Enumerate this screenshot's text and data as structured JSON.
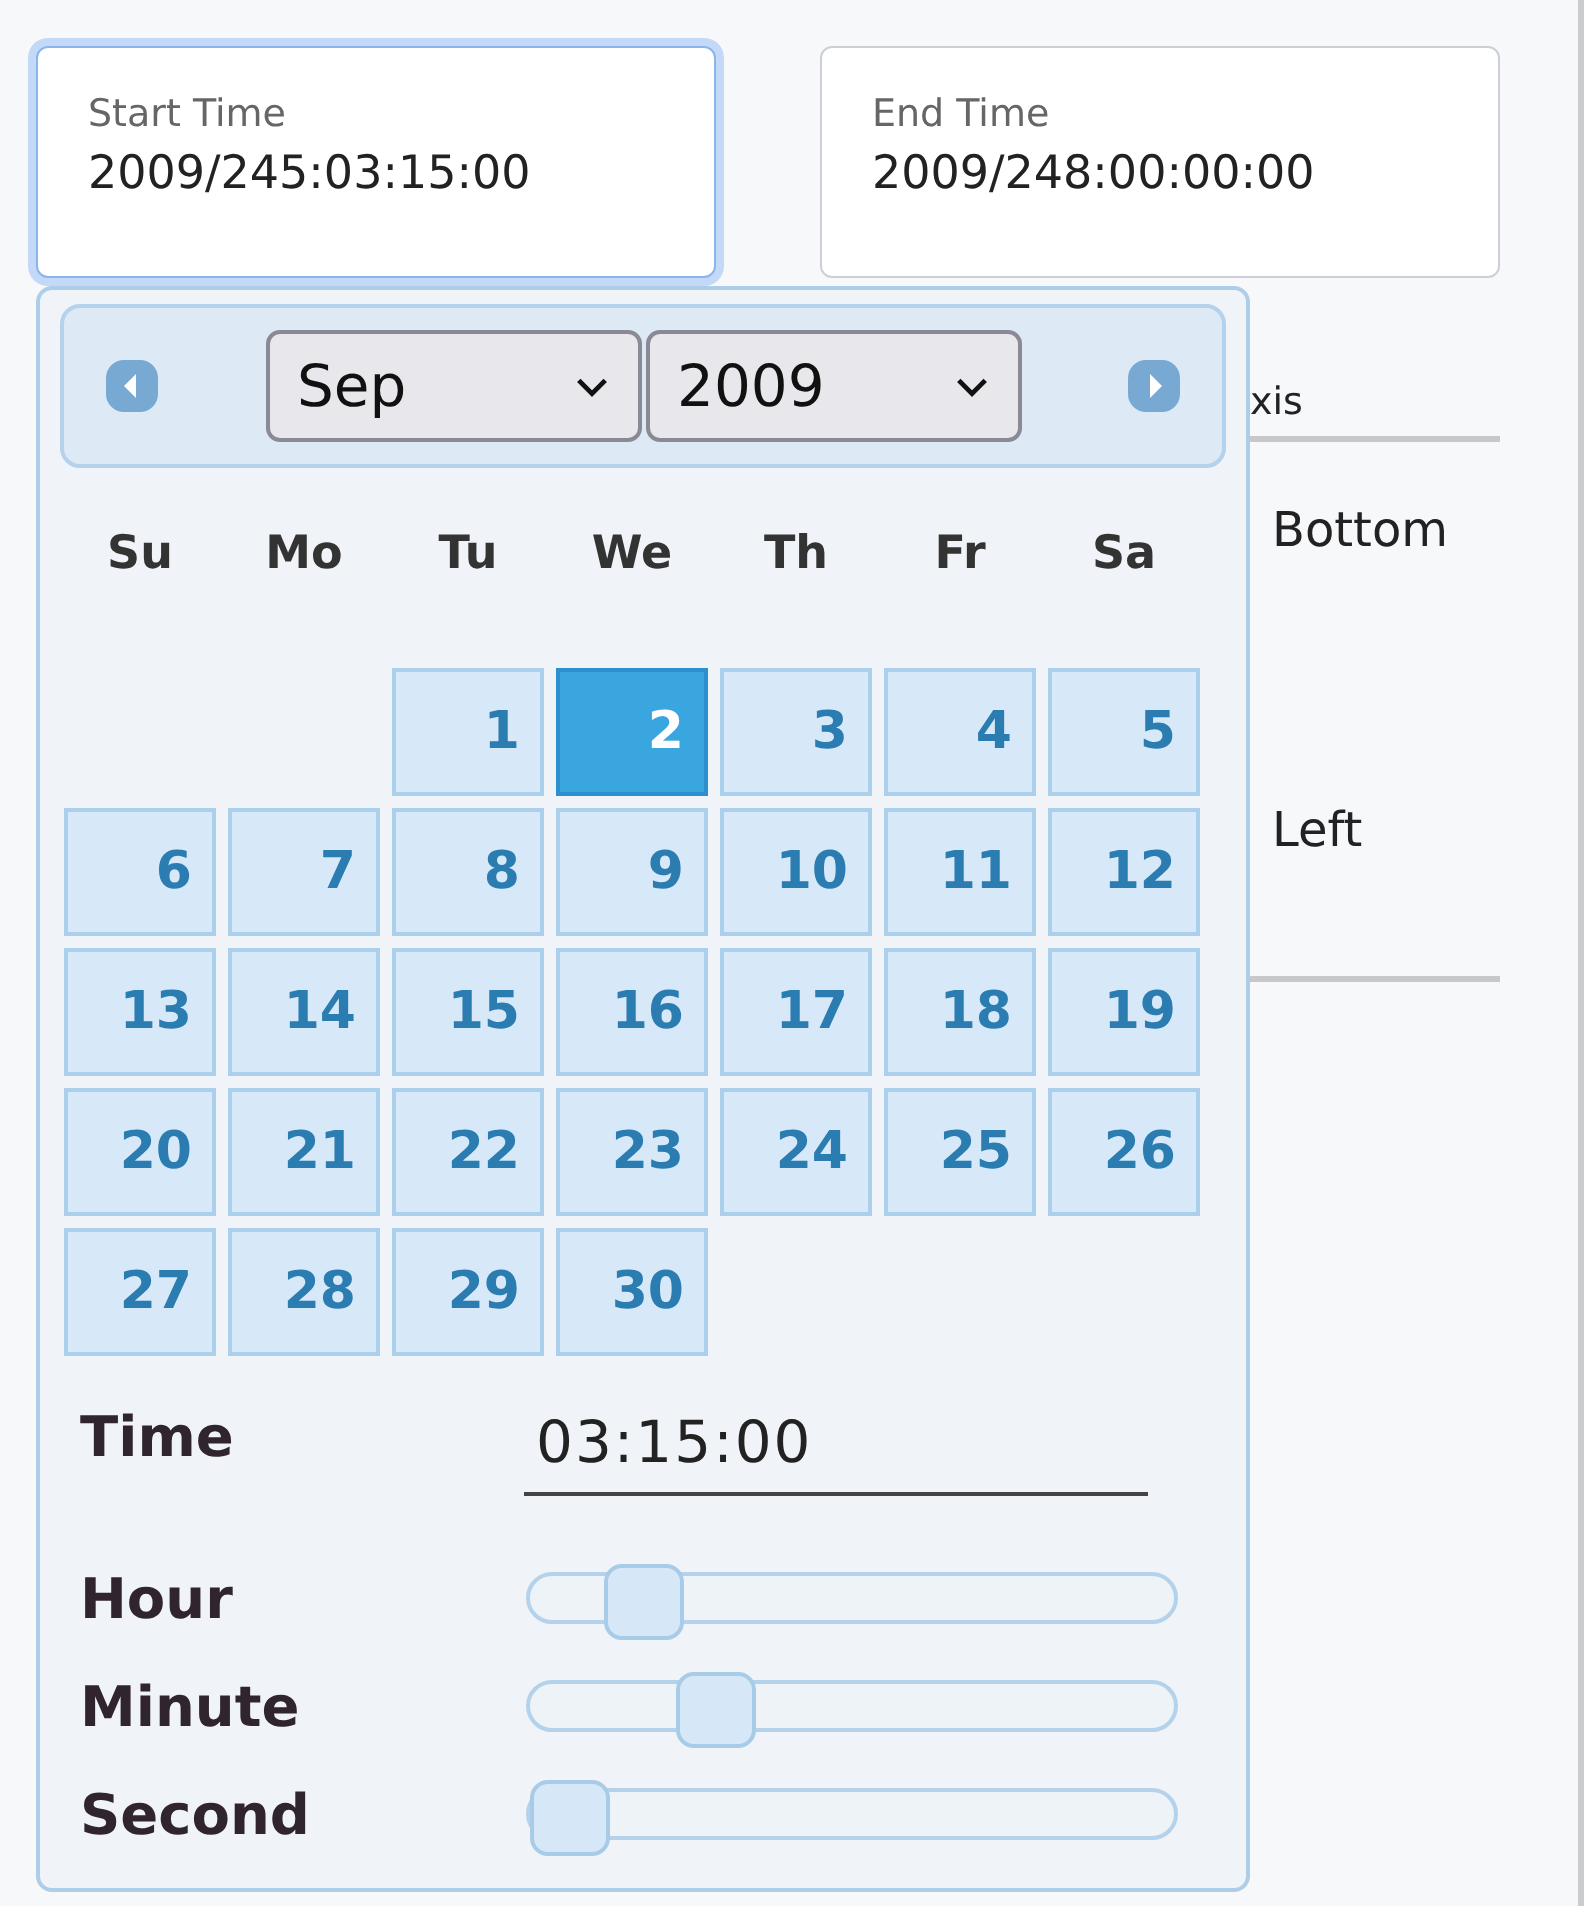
{
  "fields": [
    {
      "label": "Start Time",
      "value": "2009/245:03:15:00",
      "focused": true
    },
    {
      "label": "End Time",
      "value": "2009/248:00:00:00",
      "focused": false
    }
  ],
  "axis_panel": {
    "header": "xis",
    "options": [
      "Bottom",
      "Left"
    ]
  },
  "datepicker": {
    "month": "Sep",
    "year": "2009",
    "weekdays": [
      "Su",
      "Mo",
      "Tu",
      "We",
      "Th",
      "Fr",
      "Sa"
    ],
    "days": [
      {
        "kind": "blank"
      },
      {
        "kind": "blank"
      },
      {
        "label": "1",
        "selected": false
      },
      {
        "label": "2",
        "selected": true
      },
      {
        "label": "3",
        "selected": false
      },
      {
        "label": "4",
        "selected": false
      },
      {
        "label": "5",
        "selected": false
      },
      {
        "label": "6",
        "selected": false
      },
      {
        "label": "7",
        "selected": false
      },
      {
        "label": "8",
        "selected": false
      },
      {
        "label": "9",
        "selected": false
      },
      {
        "label": "10",
        "selected": false
      },
      {
        "label": "11",
        "selected": false
      },
      {
        "label": "12",
        "selected": false
      },
      {
        "label": "13",
        "selected": false
      },
      {
        "label": "14",
        "selected": false
      },
      {
        "label": "15",
        "selected": false
      },
      {
        "label": "16",
        "selected": false
      },
      {
        "label": "17",
        "selected": false
      },
      {
        "label": "18",
        "selected": false
      },
      {
        "label": "19",
        "selected": false
      },
      {
        "label": "20",
        "selected": false
      },
      {
        "label": "21",
        "selected": false
      },
      {
        "label": "22",
        "selected": false
      },
      {
        "label": "23",
        "selected": false
      },
      {
        "label": "24",
        "selected": false
      },
      {
        "label": "25",
        "selected": false
      },
      {
        "label": "26",
        "selected": false
      },
      {
        "label": "27",
        "selected": false
      },
      {
        "label": "28",
        "selected": false
      },
      {
        "label": "29",
        "selected": false
      },
      {
        "label": "30",
        "selected": false
      }
    ],
    "time_label": "Time",
    "time_value": "03:15:00",
    "sliders": [
      {
        "label": "Hour",
        "level": 0.13
      },
      {
        "label": "Minute",
        "level": 0.26
      },
      {
        "label": "Second",
        "level": 0.0
      }
    ]
  }
}
